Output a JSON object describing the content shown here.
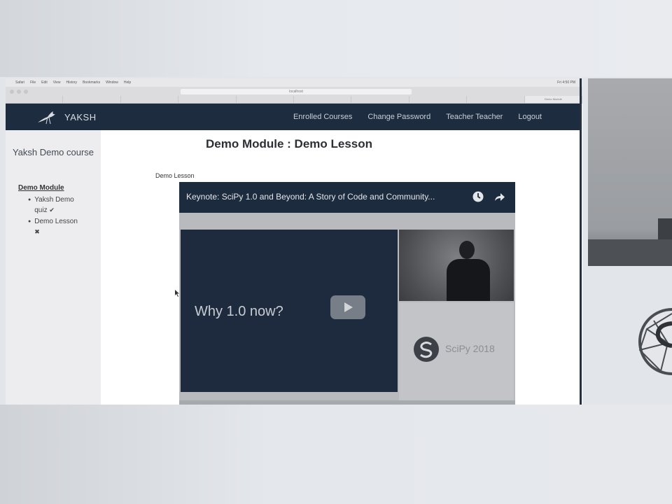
{
  "mac_menubar": {
    "items": [
      "Safari",
      "File",
      "Edit",
      "View",
      "History",
      "Bookmarks",
      "Window",
      "Help"
    ],
    "right": "Fri 4:50 PM"
  },
  "browser": {
    "url": "localhost",
    "tabs": [
      "",
      "",
      "",
      "",
      "",
      "",
      "",
      "",
      "",
      "Demo Module"
    ]
  },
  "navbar": {
    "brand": "YAKSH",
    "links": [
      "Enrolled Courses",
      "Change Password",
      "Teacher Teacher",
      "Logout"
    ]
  },
  "sidebar": {
    "course_title": "Yaksh Demo course",
    "module": "Demo Module",
    "items": [
      {
        "label": "Yaksh Demo quiz",
        "status": "check-mark"
      },
      {
        "label": "Demo Lesson",
        "status": "cross-mark"
      }
    ]
  },
  "main": {
    "page_title": "Demo Module : Demo Lesson",
    "lesson_caption": "Demo Lesson"
  },
  "video": {
    "title": "Keynote: SciPy 1.0 and Beyond: A Story of Code and Community...",
    "slide_text": "Why 1.0 now?",
    "scipy_label": "SciPy 2018"
  },
  "colors": {
    "navbar": "#1e2c3f",
    "video_bar": "#1c2b3d",
    "slide_bg": "#1e2b3e"
  }
}
